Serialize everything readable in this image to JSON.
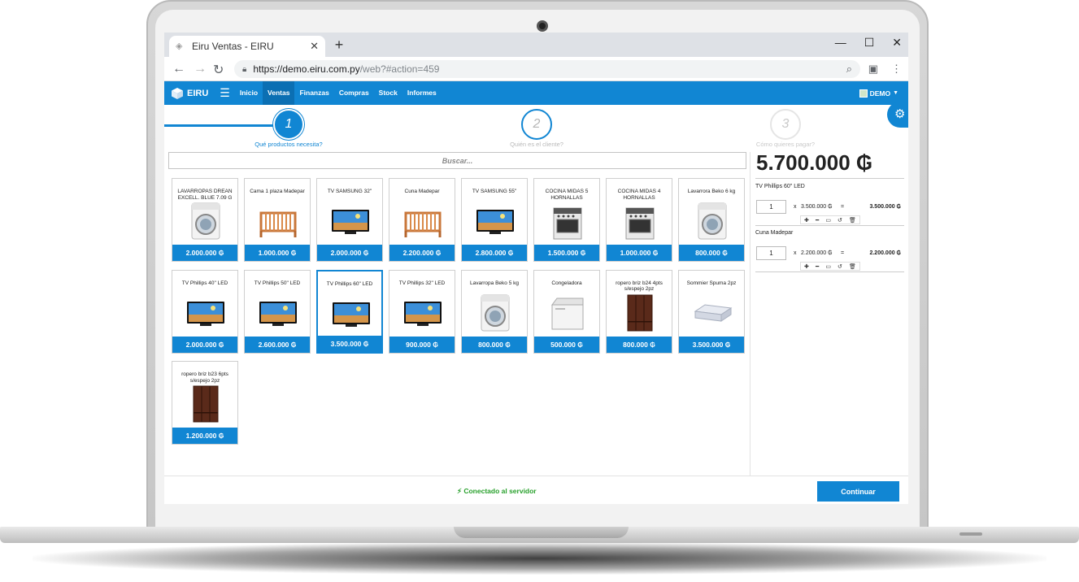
{
  "browser": {
    "tab_title": "Eiru Ventas - EIRU",
    "new_tab": "+",
    "url_host": "https://demo.eiru.com.py",
    "url_path": "/web?#action=459"
  },
  "app": {
    "brand": "EIRU",
    "nav": [
      "Inicio",
      "Ventas",
      "Finanzas",
      "Compras",
      "Stock",
      "Informes"
    ],
    "active_nav": "Ventas",
    "user": "DEMO"
  },
  "wizard": {
    "steps": [
      {
        "number": "1",
        "label": "Qué productos necesita?"
      },
      {
        "number": "2",
        "label": "Quién es el cliente?"
      },
      {
        "number": "3",
        "label": "Cómo quieres pagar?"
      }
    ]
  },
  "search": {
    "placeholder": "Buscar..."
  },
  "products": [
    {
      "name": "LAVARROPAS DREAN EXCELL. BLUE 7.09 G",
      "price": "2.000.000 ₲",
      "icon": "washer-icon"
    },
    {
      "name": "Cama 1 plaza Madepar",
      "price": "1.000.000 ₲",
      "icon": "crib-icon"
    },
    {
      "name": "TV SAMSUNG 32\"",
      "price": "2.000.000 ₲",
      "icon": "tv-icon"
    },
    {
      "name": "Cuna Madepar",
      "price": "2.200.000 ₲",
      "icon": "crib-icon"
    },
    {
      "name": "TV SAMSUNG 55\"",
      "price": "2.800.000 ₲",
      "icon": "tv-icon"
    },
    {
      "name": "COCINA MIDAS 5 HORNALLAS",
      "price": "1.500.000 ₲",
      "icon": "stove-icon"
    },
    {
      "name": "COCINA MIDAS 4 HORNALLAS",
      "price": "1.000.000 ₲",
      "icon": "stove-icon"
    },
    {
      "name": "Lavarrora Beko 6 kg",
      "price": "800.000 ₲",
      "icon": "washer-icon"
    },
    {
      "name": "TV Phillips 40\" LED",
      "price": "2.000.000 ₲",
      "icon": "tv-icon"
    },
    {
      "name": "TV Phillips 50\" LED",
      "price": "2.600.000 ₲",
      "icon": "tv-icon"
    },
    {
      "name": "TV Phillips 60\" LED",
      "price": "3.500.000 ₲",
      "icon": "tv-icon",
      "selected": true
    },
    {
      "name": "TV Phillips 32\" LED",
      "price": "900.000 ₲",
      "icon": "tv-icon"
    },
    {
      "name": "Lavarropa Beko 5 kg",
      "price": "800.000 ₲",
      "icon": "washer-icon"
    },
    {
      "name": "Congeladora",
      "price": "500.000 ₲",
      "icon": "freezer-icon"
    },
    {
      "name": "ropero briz b24 4pts s/espejo 2pz",
      "price": "800.000 ₲",
      "icon": "wardrobe-icon"
    },
    {
      "name": "Sommier Spuma 2pz",
      "price": "3.500.000 ₲",
      "icon": "mattress-icon"
    },
    {
      "name": "ropero briz b23 6pts s/espejo 2pz",
      "price": "1.200.000 ₲",
      "icon": "wardrobe-icon"
    }
  ],
  "cart": {
    "total": "5.700.000 ₲",
    "items": [
      {
        "name": "TV Phillips 60\" LED",
        "qty": "1",
        "x": "x",
        "unit_price": "3.500.000 ₲",
        "eq": "=",
        "subtotal": "3.500.000 ₲"
      },
      {
        "name": "Cuna Madepar",
        "qty": "1",
        "x": "x",
        "unit_price": "2.200.000 ₲",
        "eq": "=",
        "subtotal": "2.200.000 ₲"
      }
    ]
  },
  "footer": {
    "status": "Conectado al servidor",
    "continue_label": "Continuar"
  },
  "colors": {
    "brand": "#1186d3",
    "status_ok": "#27a02b"
  }
}
